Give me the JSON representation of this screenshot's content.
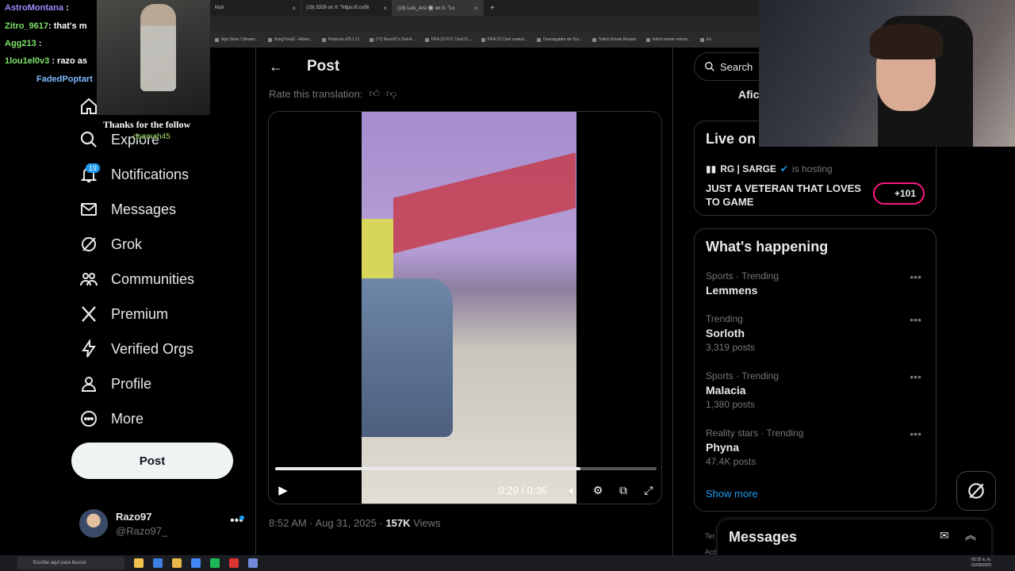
{
  "browser": {
    "tabs": [
      {
        "label": "Kick",
        "active": false
      },
      {
        "label": "(19) 3328 on X: \"https://t.co/9i",
        "active": false
      },
      {
        "label": "(19) Luis_Arsi 🔘 on X: \"Lo",
        "active": true
      }
    ],
    "new_tab": "+",
    "bookmarks": [
      "App Store / Stream...",
      "SongTrivia2 - Adivin...",
      "Pastools v25.1.11",
      "(77) Razo97's Zed-A...",
      "FIFA 23 FUT Card Cr...",
      "FIFA 23 Card creator...",
      "Descargador de You...",
      "Twitch Emote Resizer",
      "twitch emote resizer...",
      "Ez"
    ]
  },
  "stream_overlay": {
    "chat": [
      {
        "user": "AstroMontana",
        "message": ":",
        "color": "#9b8cff"
      },
      {
        "user": "Zitro_9617",
        "message": ": that's m",
        "color": "#7fe36a"
      },
      {
        "user": "Agg213",
        "message": ":",
        "color": "#7fe36a"
      },
      {
        "user": "1lou1el0v3",
        "message": ": razo as",
        "color": "#7fe36a"
      },
      {
        "user": "FadedPoptart",
        "message": "",
        "color": "#7fb9ff"
      }
    ],
    "follow_alert": "Thanks for the follow",
    "follower_name": "osamah45"
  },
  "nav": {
    "items": [
      {
        "label": "Explore",
        "icon": "search-icon"
      },
      {
        "label": "Notifications",
        "icon": "bell-icon"
      },
      {
        "label": "Messages",
        "icon": "mail-icon"
      },
      {
        "label": "Grok",
        "icon": "grok-icon"
      },
      {
        "label": "Communities",
        "icon": "communities-icon"
      },
      {
        "label": "Premium",
        "icon": "x-logo-icon"
      },
      {
        "label": "Verified Orgs",
        "icon": "lightning-icon"
      },
      {
        "label": "Profile",
        "icon": "person-icon"
      },
      {
        "label": "More",
        "icon": "more-circle-icon"
      }
    ],
    "notification_count": "19",
    "post_button": "Post",
    "account": {
      "name": "Razo97",
      "handle": "@Razo97_",
      "more": "•••"
    }
  },
  "main": {
    "title": "Post",
    "rate_translation": "Rate this translation:",
    "video": {
      "current": "0:29",
      "duration": "0:36",
      "time_label": "0:29 / 0:36",
      "progress": 0.8
    },
    "timestamp": "8:52 AM · Aug 31, 2025 · ",
    "views_count": "157K",
    "views_label": " Views"
  },
  "right": {
    "search_placeholder": "Search",
    "partial_label": "Afici",
    "live": {
      "title": "Live on X",
      "host_name": "RG | SARGE",
      "host_text": "is hosting",
      "description": "JUST A VETERAN THAT LOVES TO GAME",
      "listeners": "+101"
    },
    "happening": {
      "title": "What's happening",
      "trends": [
        {
          "context": "Sports · Trending",
          "name": "Lemmens",
          "posts": ""
        },
        {
          "context": "Trending",
          "name": "Sorloth",
          "posts": "3,319 posts"
        },
        {
          "context": "Sports · Trending",
          "name": "Malacia",
          "posts": "1,380 posts"
        },
        {
          "context": "Reality stars · Trending",
          "name": "Phyna",
          "posts": "47.4K posts"
        }
      ],
      "show_more": "Show more"
    },
    "footer_partial": [
      "Ter",
      "Acc"
    ],
    "messages_drawer": "Messages"
  },
  "taskbar": {
    "search_placeholder": "Escribe aquí para buscar",
    "language": "ESP",
    "time": "02:32 a. m.",
    "date": "01/09/2025"
  },
  "colors": {
    "accent": "#1d9bf0",
    "live_pink": "#f91880",
    "background": "#000000"
  }
}
